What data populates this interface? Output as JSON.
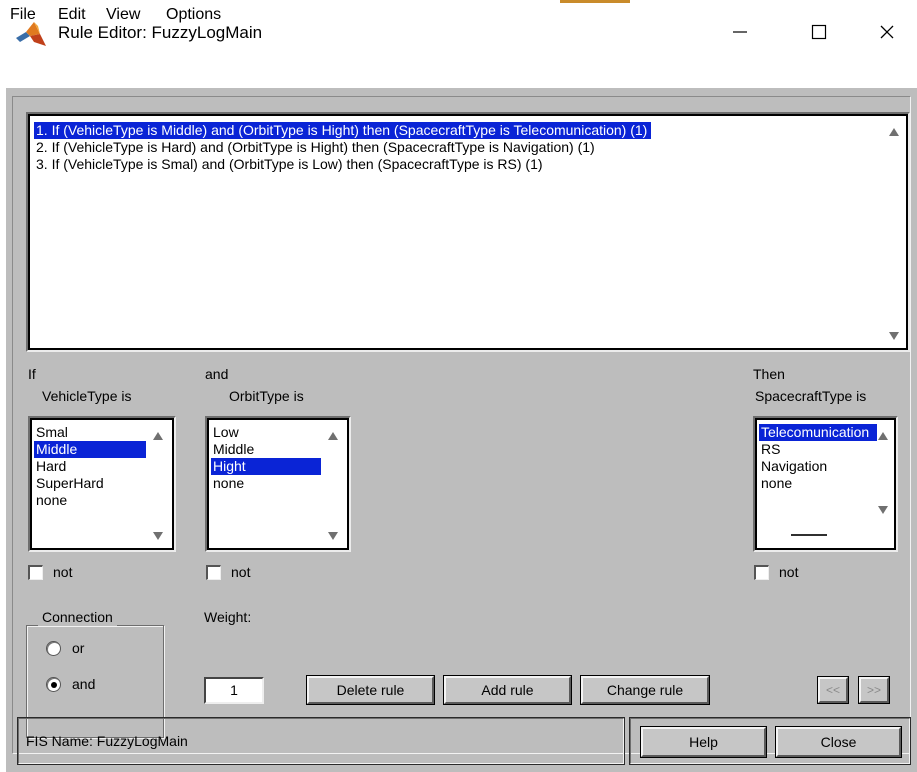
{
  "window": {
    "title": "Rule Editor: FuzzyLogMain",
    "minimize_glyph": "—",
    "maximize_glyph": "☐",
    "close_glyph": "✕",
    "logo_icon": "matlab-logo-icon"
  },
  "menu": {
    "items": [
      "File",
      "Edit",
      "View",
      "Options"
    ]
  },
  "rules": {
    "items": [
      "1. If (VehicleType is Middle) and (OrbitType is Hight) then (SpacecraftType is Telecomunication) (1)",
      "2. If (VehicleType is Hard) and (OrbitType is Hight) then (SpacecraftType is Navigation) (1)",
      "3. If (VehicleType is Smal) and (OrbitType is Low) then (SpacecraftType is RS) (1)"
    ],
    "selected_index": 0
  },
  "antecedent1": {
    "connector": "If",
    "label": "VehicleType is",
    "options": [
      "Smal",
      "Middle",
      "Hard",
      "SuperHard",
      "none"
    ],
    "selected": "Middle",
    "not_label": "not"
  },
  "antecedent2": {
    "connector": "and",
    "label": "OrbitType is",
    "options": [
      "Low",
      "Middle",
      "Hight",
      "none"
    ],
    "selected": "Hight",
    "not_label": "not"
  },
  "consequent": {
    "connector": "Then",
    "label": "SpacecraftType is",
    "options": [
      "Telecomunication",
      "RS",
      "Navigation",
      "none"
    ],
    "selected": "Telecomunication",
    "not_label": "not"
  },
  "connection": {
    "title": "Connection",
    "options": [
      "or",
      "and"
    ],
    "selected": "and"
  },
  "weight": {
    "label": "Weight:",
    "value": "1"
  },
  "buttons": {
    "delete": "Delete rule",
    "add": "Add rule",
    "change": "Change rule",
    "prev": "<<",
    "next": ">>",
    "help": "Help",
    "close": "Close"
  },
  "status": {
    "text": "FIS Name: FuzzyLogMain"
  },
  "colors": {
    "figure_bg": "#bdbdbd",
    "selection": "#0a24d6",
    "accent_strip": "#c98b2a"
  }
}
